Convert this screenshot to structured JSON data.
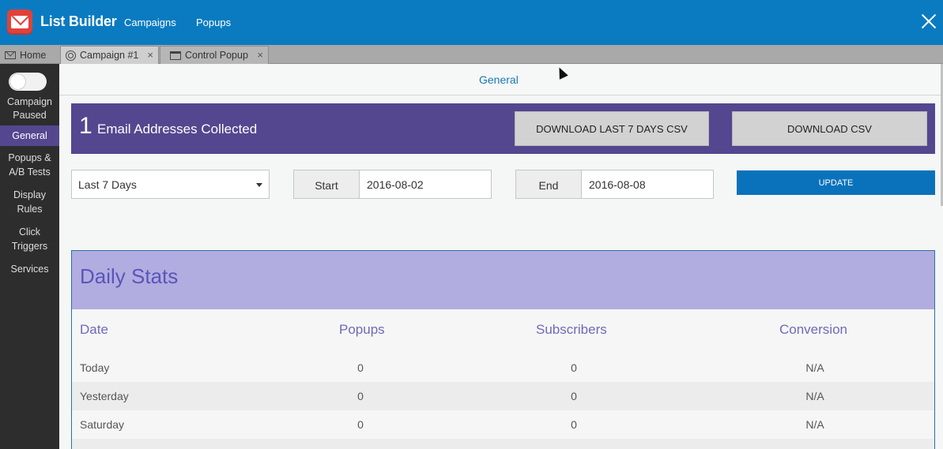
{
  "app": {
    "title": "List Builder",
    "nav": [
      "Campaigns",
      "Popups"
    ],
    "accent": "#0a7bc0",
    "brand_purple": "#54478f"
  },
  "tabs": [
    {
      "label": "Home",
      "icon": "envelope-icon",
      "closable": false
    },
    {
      "label": "Campaign #1",
      "icon": "target-icon",
      "closable": true,
      "active": true
    },
    {
      "label": "Control Popup",
      "icon": "window-icon",
      "closable": true
    }
  ],
  "tab_close_glyph": "×",
  "sidebar": {
    "toggle_label": "Campaign Paused",
    "items": [
      {
        "label": "General",
        "active": true
      },
      {
        "label": "Popups & A/B Tests"
      },
      {
        "label": "Display Rules"
      },
      {
        "label": "Click Triggers"
      },
      {
        "label": "Services"
      }
    ]
  },
  "main": {
    "subtab": "General",
    "collected": {
      "count": "1",
      "label": "Email Addresses Collected",
      "download_last7": "DOWNLOAD LAST 7 DAYS CSV",
      "download_csv": "DOWNLOAD CSV"
    },
    "filters": {
      "range": "Last 7 Days",
      "start_label": "Start",
      "start_value": "2016-08-02",
      "end_label": "End",
      "end_value": "2016-08-08",
      "update": "UPDATE"
    },
    "stats": {
      "title": "Daily Stats",
      "columns": [
        "Date",
        "Popups",
        "Subscribers",
        "Conversion"
      ],
      "rows": [
        [
          "Today",
          "0",
          "0",
          "N/A"
        ],
        [
          "Yesterday",
          "0",
          "0",
          "N/A"
        ],
        [
          "Saturday",
          "0",
          "0",
          "N/A"
        ]
      ]
    }
  }
}
